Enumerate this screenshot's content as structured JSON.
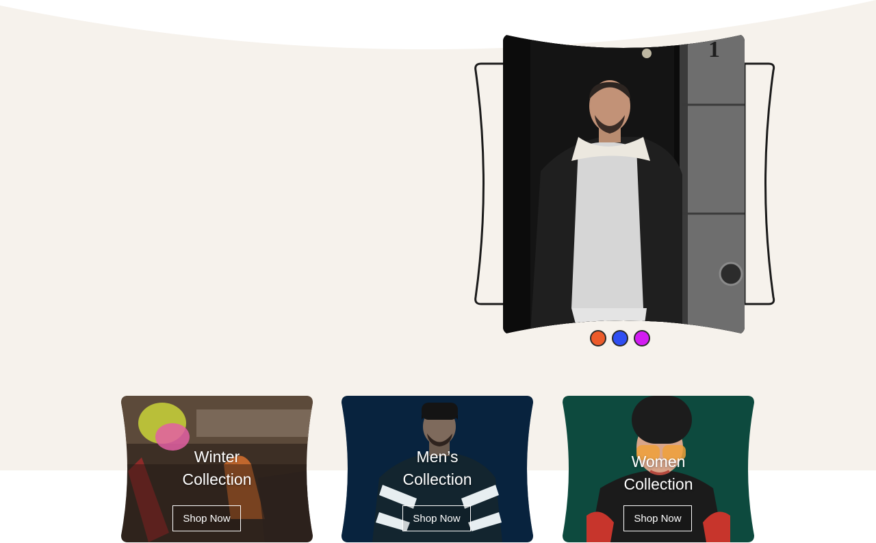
{
  "hero": {
    "frame_number": "1",
    "dots": [
      {
        "color": "#ec5b2b",
        "label": "slide-1"
      },
      {
        "color": "#2f4ef2",
        "label": "slide-2"
      },
      {
        "color": "#d31cf2",
        "label": "slide-3"
      }
    ]
  },
  "collections": [
    {
      "title_line1": "Winter",
      "title_line2": "Collection",
      "button": "Shop Now"
    },
    {
      "title_line1": "Men’s",
      "title_line2": "Collection",
      "button": "Shop Now"
    },
    {
      "title_line1": "Women",
      "title_line2": "Collection",
      "button": "Shop Now"
    }
  ],
  "colors": {
    "hero_bg": "#f6f2ec",
    "page_bg": "#ffffff",
    "outline": "#1a1a1a"
  }
}
